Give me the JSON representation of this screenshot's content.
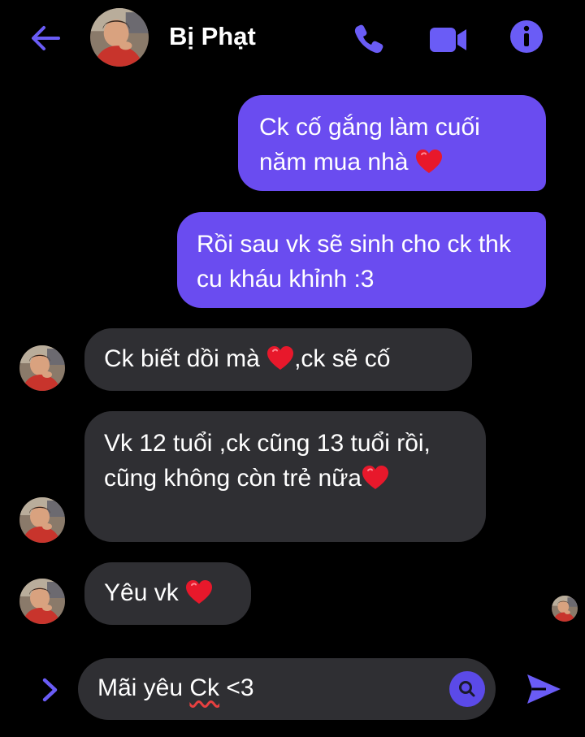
{
  "header": {
    "name": "Bị Phạt",
    "icons": [
      "arrow-left-icon",
      "phone-icon",
      "video-camera-icon",
      "info-icon"
    ]
  },
  "messages": [
    {
      "from": "me",
      "text": "Ck cố gắng làm cuối năm mua nhà",
      "suffix": "heart"
    },
    {
      "from": "me",
      "text": "Rồi sau vk sẽ sinh cho ck thk cu kháu khỉnh :3"
    },
    {
      "from": "them",
      "text_before": "Ck biết dồi mà ",
      "suffix": "heart",
      "text_after": ",ck sẽ cố"
    },
    {
      "from": "them",
      "text": "Vk  12 tuổi ,ck cũng 13 tuổi rồi, cũng không còn trẻ nữa",
      "suffix": "heart"
    },
    {
      "from": "them",
      "text": "Yêu vk ",
      "suffix": "heart"
    }
  ],
  "composer": {
    "text_prefix": "Mãi yêu ",
    "text_misspelled": "Ck",
    "text_suffix": " <3"
  },
  "colors": {
    "accent": "#6a4cf0",
    "incoming_bubble": "#2f2f33",
    "heart": "#e8182b",
    "background": "#000000"
  }
}
